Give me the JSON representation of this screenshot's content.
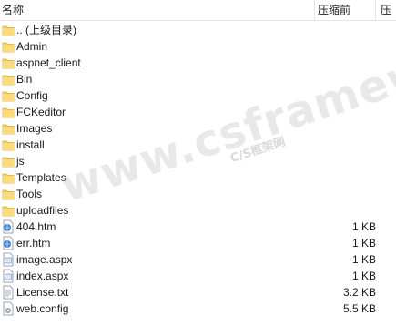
{
  "columns": {
    "name": "名称",
    "compressed": "压缩前",
    "compressed2": "压"
  },
  "watermark": {
    "main": "www.csframework.com",
    "sub": "C/S框架网"
  },
  "rows": [
    {
      "name": ".. (上级目录)",
      "size": "",
      "icon": "folder-icon"
    },
    {
      "name": "Admin",
      "size": "",
      "icon": "folder-icon"
    },
    {
      "name": "aspnet_client",
      "size": "",
      "icon": "folder-icon"
    },
    {
      "name": "Bin",
      "size": "",
      "icon": "folder-icon"
    },
    {
      "name": "Config",
      "size": "",
      "icon": "folder-icon"
    },
    {
      "name": "FCKeditor",
      "size": "",
      "icon": "folder-icon"
    },
    {
      "name": "Images",
      "size": "",
      "icon": "folder-icon"
    },
    {
      "name": "install",
      "size": "",
      "icon": "folder-icon"
    },
    {
      "name": "js",
      "size": "",
      "icon": "folder-icon"
    },
    {
      "name": "Templates",
      "size": "",
      "icon": "folder-icon"
    },
    {
      "name": "Tools",
      "size": "",
      "icon": "folder-icon"
    },
    {
      "name": "uploadfiles",
      "size": "",
      "icon": "folder-icon"
    },
    {
      "name": "404.htm",
      "size": "1 KB",
      "icon": "html-file-icon"
    },
    {
      "name": "err.htm",
      "size": "1 KB",
      "icon": "html-file-icon"
    },
    {
      "name": "image.aspx",
      "size": "1 KB",
      "icon": "aspx-file-icon"
    },
    {
      "name": "index.aspx",
      "size": "1 KB",
      "icon": "aspx-file-icon"
    },
    {
      "name": "License.txt",
      "size": "3.2 KB",
      "icon": "text-file-icon"
    },
    {
      "name": "web.config",
      "size": "5.5 KB",
      "icon": "config-file-icon"
    }
  ]
}
